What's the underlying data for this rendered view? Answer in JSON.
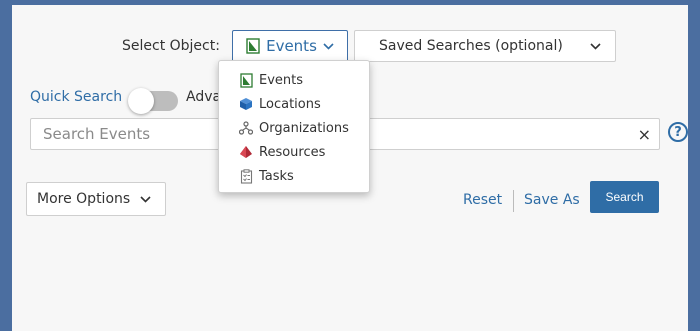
{
  "select_object": {
    "label": "Select Object:",
    "selected": "Events",
    "saved_searches": "Saved Searches (optional)"
  },
  "dropdown": {
    "items": [
      {
        "label": "Events",
        "icon": "events-icon"
      },
      {
        "label": "Locations",
        "icon": "locations-cube-icon"
      },
      {
        "label": "Organizations",
        "icon": "organizations-icon"
      },
      {
        "label": "Resources",
        "icon": "resources-icon"
      },
      {
        "label": "Tasks",
        "icon": "tasks-clipboard-icon"
      }
    ]
  },
  "quick_search": {
    "label": "Quick Search",
    "advanced_label": "Adva",
    "toggle_on": false
  },
  "search": {
    "placeholder": "Search Events",
    "clear_symbol": "×",
    "help_symbol": "?"
  },
  "options": {
    "more_options": "More Options",
    "reset": "Reset",
    "save_as": "Save As",
    "search_button": "Search"
  },
  "colors": {
    "background": "#4b6ea0",
    "accent": "#2f6da6"
  }
}
